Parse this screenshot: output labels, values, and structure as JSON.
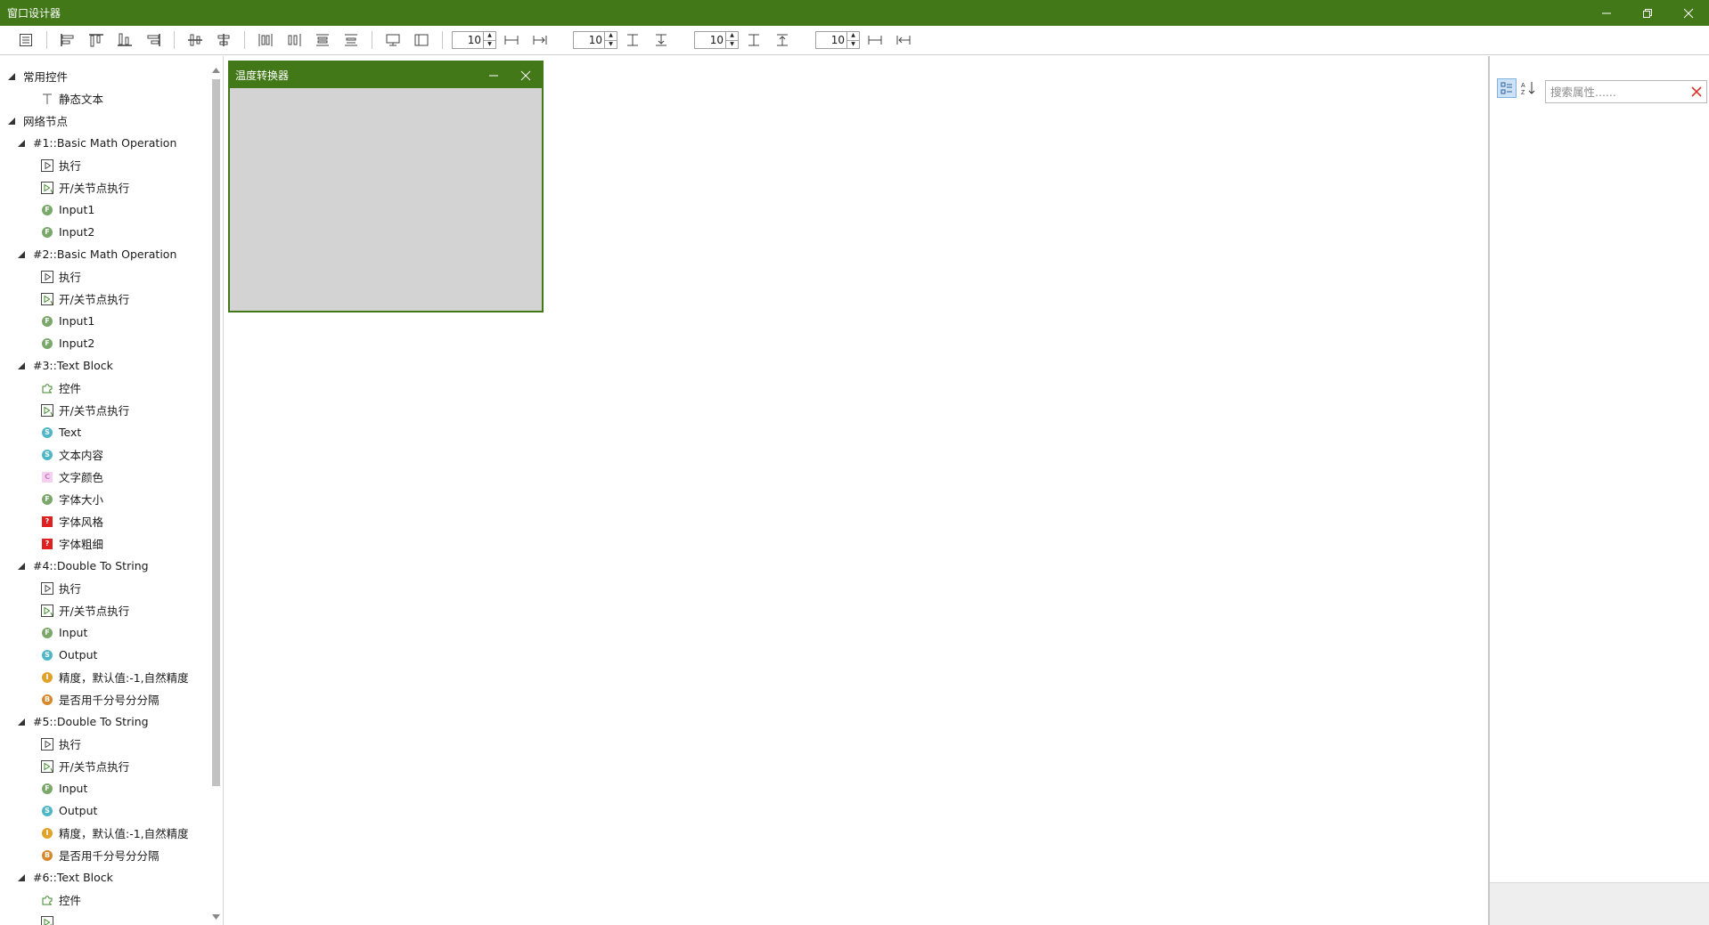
{
  "window": {
    "title": "窗口设计器"
  },
  "toolbar": {
    "spinners": [
      {
        "value": "10"
      },
      {
        "value": "10"
      },
      {
        "value": "10"
      },
      {
        "value": "10"
      }
    ]
  },
  "tree": {
    "items": [
      {
        "level": 0,
        "label": "常用控件",
        "icon": "collapse-arrow"
      },
      {
        "level": 2,
        "label": "静态文本",
        "icon": "text-tool-icon"
      },
      {
        "level": 0,
        "label": "网络节点",
        "icon": "collapse-arrow"
      },
      {
        "level": 1,
        "label": "#1::Basic Math Operation",
        "icon": "collapse-arrow"
      },
      {
        "level": 2,
        "label": "执行",
        "icon": "execute-icon"
      },
      {
        "level": 2,
        "label": "开/关节点执行",
        "icon": "toggle-execute-icon"
      },
      {
        "level": 2,
        "label": "Input1",
        "icon": "float-pin-icon"
      },
      {
        "level": 2,
        "label": "Input2",
        "icon": "float-pin-icon"
      },
      {
        "level": 1,
        "label": "#2::Basic Math Operation",
        "icon": "collapse-arrow"
      },
      {
        "level": 2,
        "label": "执行",
        "icon": "execute-icon"
      },
      {
        "level": 2,
        "label": "开/关节点执行",
        "icon": "toggle-execute-icon"
      },
      {
        "level": 2,
        "label": "Input1",
        "icon": "float-pin-icon"
      },
      {
        "level": 2,
        "label": "Input2",
        "icon": "float-pin-icon"
      },
      {
        "level": 1,
        "label": "#3::Text Block",
        "icon": "collapse-arrow"
      },
      {
        "level": 2,
        "label": "控件",
        "icon": "widget-puzzle-icon"
      },
      {
        "level": 2,
        "label": "开/关节点执行",
        "icon": "toggle-execute-icon"
      },
      {
        "level": 2,
        "label": "Text",
        "icon": "string-pin-icon"
      },
      {
        "level": 2,
        "label": "文本内容",
        "icon": "string-pin-icon"
      },
      {
        "level": 2,
        "label": "文字颜色",
        "icon": "color-pin-icon"
      },
      {
        "level": 2,
        "label": "字体大小",
        "icon": "float-pin-icon"
      },
      {
        "level": 2,
        "label": "字体风格",
        "icon": "unknown-type-icon"
      },
      {
        "level": 2,
        "label": "字体粗细",
        "icon": "unknown-type-icon"
      },
      {
        "level": 1,
        "label": "#4::Double To String",
        "icon": "collapse-arrow"
      },
      {
        "level": 2,
        "label": "执行",
        "icon": "execute-icon"
      },
      {
        "level": 2,
        "label": "开/关节点执行",
        "icon": "toggle-execute-icon"
      },
      {
        "level": 2,
        "label": "Input",
        "icon": "float-pin-icon"
      },
      {
        "level": 2,
        "label": "Output",
        "icon": "string-pin-icon"
      },
      {
        "level": 2,
        "label": "精度，默认值:-1,自然精度",
        "icon": "integer-pin-icon"
      },
      {
        "level": 2,
        "label": "是否用千分号分分隔",
        "icon": "bool-pin-icon"
      },
      {
        "level": 1,
        "label": "#5::Double To String",
        "icon": "collapse-arrow"
      },
      {
        "level": 2,
        "label": "执行",
        "icon": "execute-icon"
      },
      {
        "level": 2,
        "label": "开/关节点执行",
        "icon": "toggle-execute-icon"
      },
      {
        "level": 2,
        "label": "Input",
        "icon": "float-pin-icon"
      },
      {
        "level": 2,
        "label": "Output",
        "icon": "string-pin-icon"
      },
      {
        "level": 2,
        "label": "精度，默认值:-1,自然精度",
        "icon": "integer-pin-icon"
      },
      {
        "level": 2,
        "label": "是否用千分号分分隔",
        "icon": "bool-pin-icon"
      },
      {
        "level": 1,
        "label": "#6::Text Block",
        "icon": "collapse-arrow"
      },
      {
        "level": 2,
        "label": "控件",
        "icon": "widget-puzzle-icon"
      },
      {
        "level": 2,
        "label": "",
        "icon": "toggle-execute-icon"
      }
    ]
  },
  "form": {
    "title": "温度转换器"
  },
  "properties": {
    "search_placeholder": "搜索属性......"
  },
  "colors": {
    "accent": "#427818",
    "form_body": "#d3d3d3"
  }
}
